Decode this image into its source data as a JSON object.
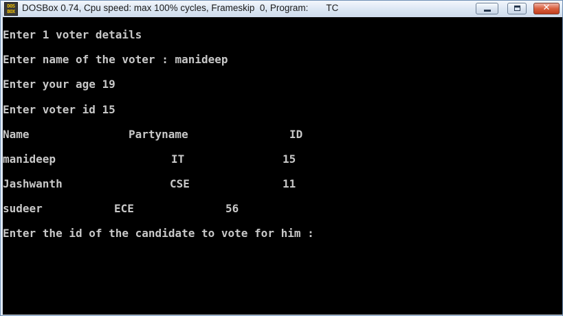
{
  "window": {
    "icon_text": "DOS BOX",
    "title": "DOSBox 0.74, Cpu speed: max 100% cycles, Frameskip  0, Program:       TC",
    "close_glyph": "✕"
  },
  "console": {
    "lines": [
      "Enter 1 voter details",
      "Enter name of the voter : manideep",
      "Enter your age 19",
      "Enter voter id 15"
    ],
    "table": {
      "headers": [
        "Name",
        "Partyname",
        "ID"
      ],
      "rows": [
        [
          "manideep",
          "IT",
          "15"
        ],
        [
          "Jashwanth",
          "CSE",
          "11"
        ],
        [
          "sudeer",
          "ECE",
          "56"
        ]
      ]
    },
    "prompt": "Enter the id of the candidate to vote for him :"
  },
  "colors": {
    "console_background": "#000000",
    "console_text": "#c8c8c8",
    "close_button": "#c8452a"
  }
}
